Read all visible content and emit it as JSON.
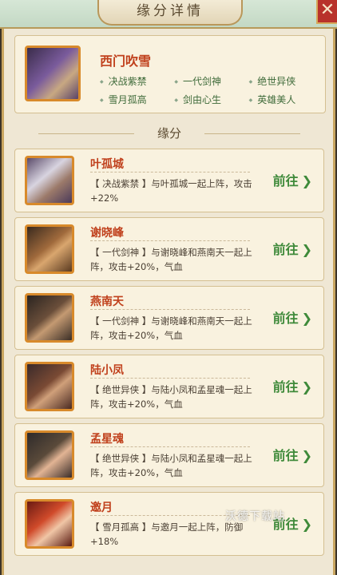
{
  "window": {
    "title": "缘分详情",
    "close_label": "✕"
  },
  "hero": {
    "name": "西门吹雪",
    "tags": [
      "决战紫禁",
      "一代剑神",
      "绝世异侠",
      "雪月孤高",
      "剑由心生",
      "英雄美人"
    ]
  },
  "section": {
    "title": "缘分"
  },
  "relations": [
    {
      "name": "叶孤城",
      "desc": "【 决战紫禁 】与叶孤城一起上阵，攻击+22%",
      "action": "前往"
    },
    {
      "name": "谢晓峰",
      "desc": "【 一代剑神 】与谢晓峰和燕南天一起上阵，攻击+20%，气血",
      "action": "前往"
    },
    {
      "name": "燕南天",
      "desc": "【 一代剑神 】与谢晓峰和燕南天一起上阵，攻击+20%，气血",
      "action": "前往"
    },
    {
      "name": "陆小凤",
      "desc": "【 绝世异侠 】与陆小凤和孟星魂一起上阵，攻击+20%，气血",
      "action": "前往"
    },
    {
      "name": "孟星魂",
      "desc": "【 绝世异侠 】与陆小凤和孟星魂一起上阵，攻击+20%，气血",
      "action": "前往"
    },
    {
      "name": "邀月",
      "desc": "【 雪月孤高 】与邀月一起上阵，防御+18%",
      "action": "前往"
    }
  ],
  "watermark": "沃德下载站"
}
